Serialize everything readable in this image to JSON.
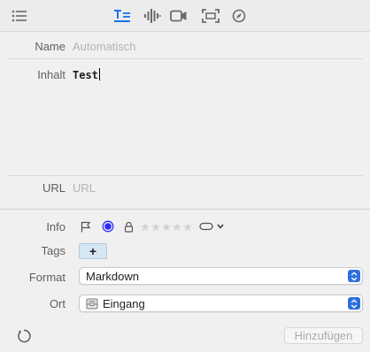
{
  "toolbar": {
    "icons": [
      "list-icon",
      "text-format-icon",
      "audio-waveform-icon",
      "video-camera-icon",
      "screen-capture-icon",
      "safari-compass-icon"
    ],
    "active": "text-format-icon",
    "accent": "#1a73e8"
  },
  "form": {
    "name": {
      "label": "Name",
      "placeholder": "Automatisch"
    },
    "inhalt": {
      "label": "Inhalt",
      "value": "Test"
    },
    "url": {
      "label": "URL",
      "placeholder": "URL"
    },
    "info": {
      "label": "Info",
      "rating": 0,
      "max_rating": 5,
      "label_color": "#2b2bff"
    },
    "tags": {
      "label": "Tags",
      "add_label": "+"
    },
    "format": {
      "label": "Format",
      "value": "Markdown"
    },
    "ort": {
      "label": "Ort",
      "value": "Eingang"
    }
  },
  "footer": {
    "add_button_label": "Hinzufügen"
  }
}
